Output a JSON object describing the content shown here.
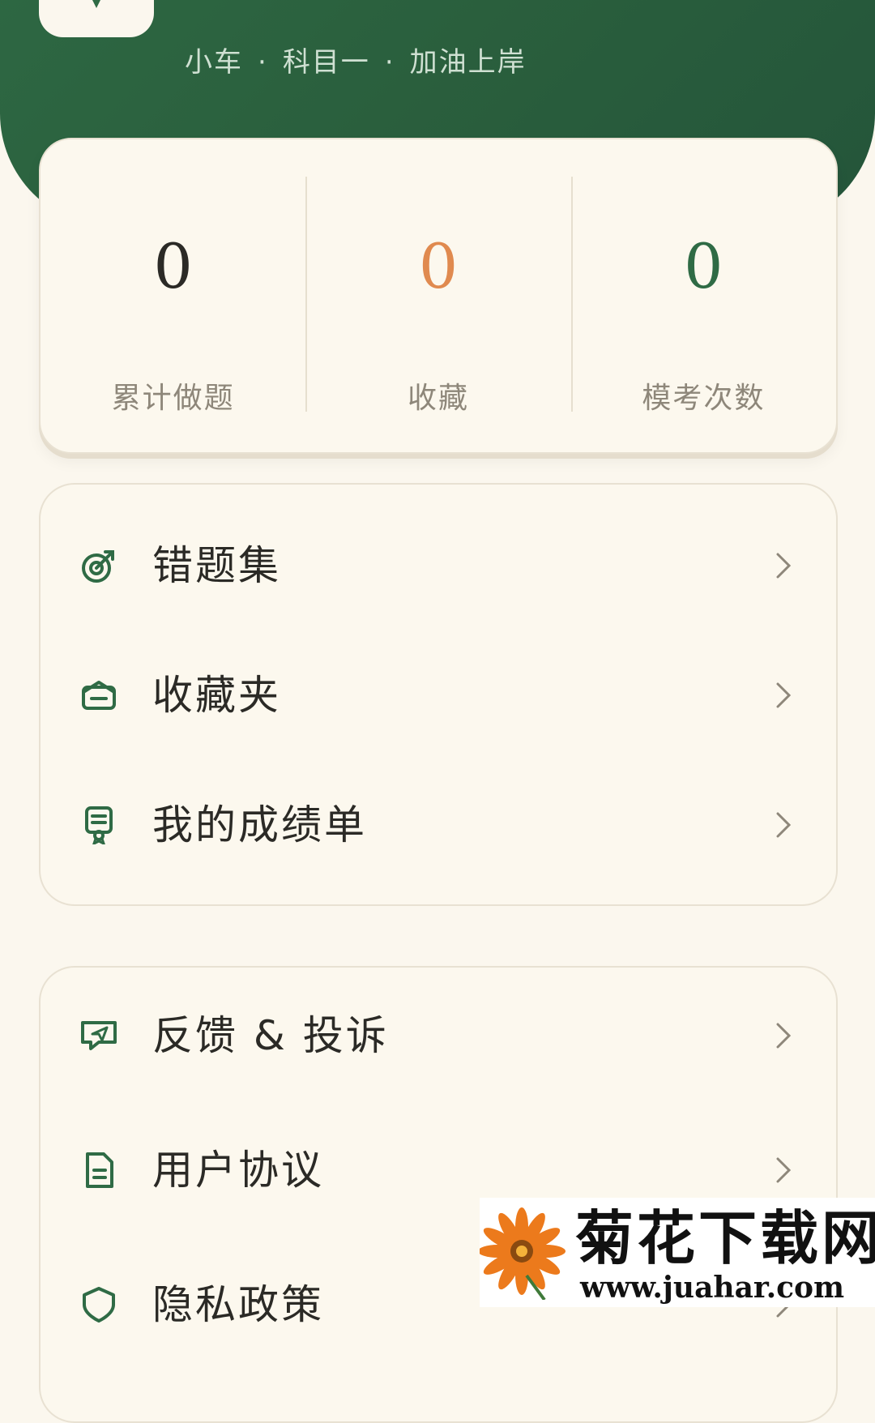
{
  "header": {
    "subtitle_parts": [
      "小车",
      "科目一",
      "加油上岸"
    ],
    "separator": "·"
  },
  "stats": [
    {
      "value": "0",
      "label": "累计做题",
      "color": "#2b2a26"
    },
    {
      "value": "0",
      "label": "收藏",
      "color": "#e08a4f"
    },
    {
      "value": "0",
      "label": "模考次数",
      "color": "#2f6b45"
    }
  ],
  "menu_primary": [
    {
      "label": "错题集",
      "icon": "target-icon"
    },
    {
      "label": "收藏夹",
      "icon": "mailbox-icon"
    },
    {
      "label": "我的成绩单",
      "icon": "certificate-icon"
    }
  ],
  "menu_secondary": [
    {
      "label": "反馈 & 投诉",
      "icon": "feedback-icon"
    },
    {
      "label": "用户协议",
      "icon": "document-icon"
    },
    {
      "label": "隐私政策",
      "icon": "shield-icon"
    }
  ],
  "watermark": {
    "title": "菊花下载网",
    "url": "www.juahar.com"
  },
  "colors": {
    "brand_green": "#2f6b45",
    "background": "#fbf7ee",
    "accent_orange": "#e08a4f"
  }
}
